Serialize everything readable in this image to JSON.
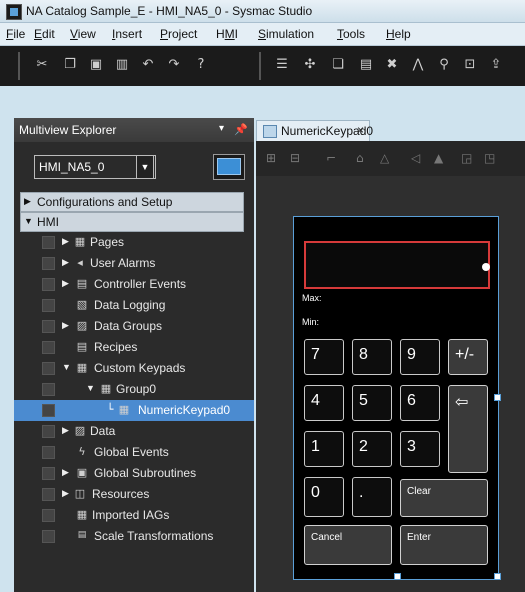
{
  "window": {
    "title": "NA Catalog Sample_E - HMI_NA5_0 - Sysmac Studio"
  },
  "menu": [
    "File",
    "Edit",
    "View",
    "Insert",
    "Project",
    "HMI",
    "Simulation",
    "Tools",
    "Help"
  ],
  "menu_underline": [
    "F",
    "E",
    "V",
    "I",
    "P",
    "M",
    "S",
    "T",
    "H"
  ],
  "explorer": {
    "title": "Multiview Explorer",
    "menu_glyph": "▾",
    "pin_glyph": "ᵩ",
    "device": "HMI_NA5_0",
    "sections": [
      "Configurations and Setup",
      "HMI"
    ],
    "items": [
      {
        "label": "Pages",
        "icon": "pages-icon"
      },
      {
        "label": "User Alarms",
        "icon": "alarm-icon"
      },
      {
        "label": "Controller Events",
        "icon": "controller-events-icon"
      },
      {
        "label": "Data Logging",
        "icon": "data-logging-icon"
      },
      {
        "label": "Data Groups",
        "icon": "data-groups-icon"
      },
      {
        "label": "Recipes",
        "icon": "recipes-icon"
      },
      {
        "label": "Custom Keypads",
        "icon": "keypads-icon"
      },
      {
        "label": "Group0",
        "icon": "group-icon"
      },
      {
        "label": "NumericKeypad0",
        "icon": "keypad-icon"
      },
      {
        "label": "Data",
        "icon": "data-icon"
      },
      {
        "label": "Global Events",
        "icon": "lightning-icon"
      },
      {
        "label": "Global Subroutines",
        "icon": "subroutines-icon"
      },
      {
        "label": "Resources",
        "icon": "resources-icon"
      },
      {
        "label": "Imported IAGs",
        "icon": "iag-icon"
      },
      {
        "label": "Scale Transformations",
        "icon": "scale-icon"
      }
    ]
  },
  "editor": {
    "tab_label": "NumericKeypad0",
    "tab_close": "×"
  },
  "keypad": {
    "max_label": "Max:",
    "min_label": "Min:",
    "keys": {
      "k7": "7",
      "k8": "8",
      "k9": "9",
      "sign": "+/-",
      "k4": "4",
      "k5": "5",
      "k6": "6",
      "back": "⇦",
      "k1": "1",
      "k2": "2",
      "k3": "3",
      "k0": "0",
      "dot": ".",
      "clear": "Clear",
      "cancel": "Cancel",
      "enter": "Enter"
    }
  },
  "colors": {
    "accent": "#4b8bd0",
    "display_border": "#d63a3a",
    "panel_bg": "#2b2b2b",
    "toolbar_bg": "#1b1b1b"
  }
}
